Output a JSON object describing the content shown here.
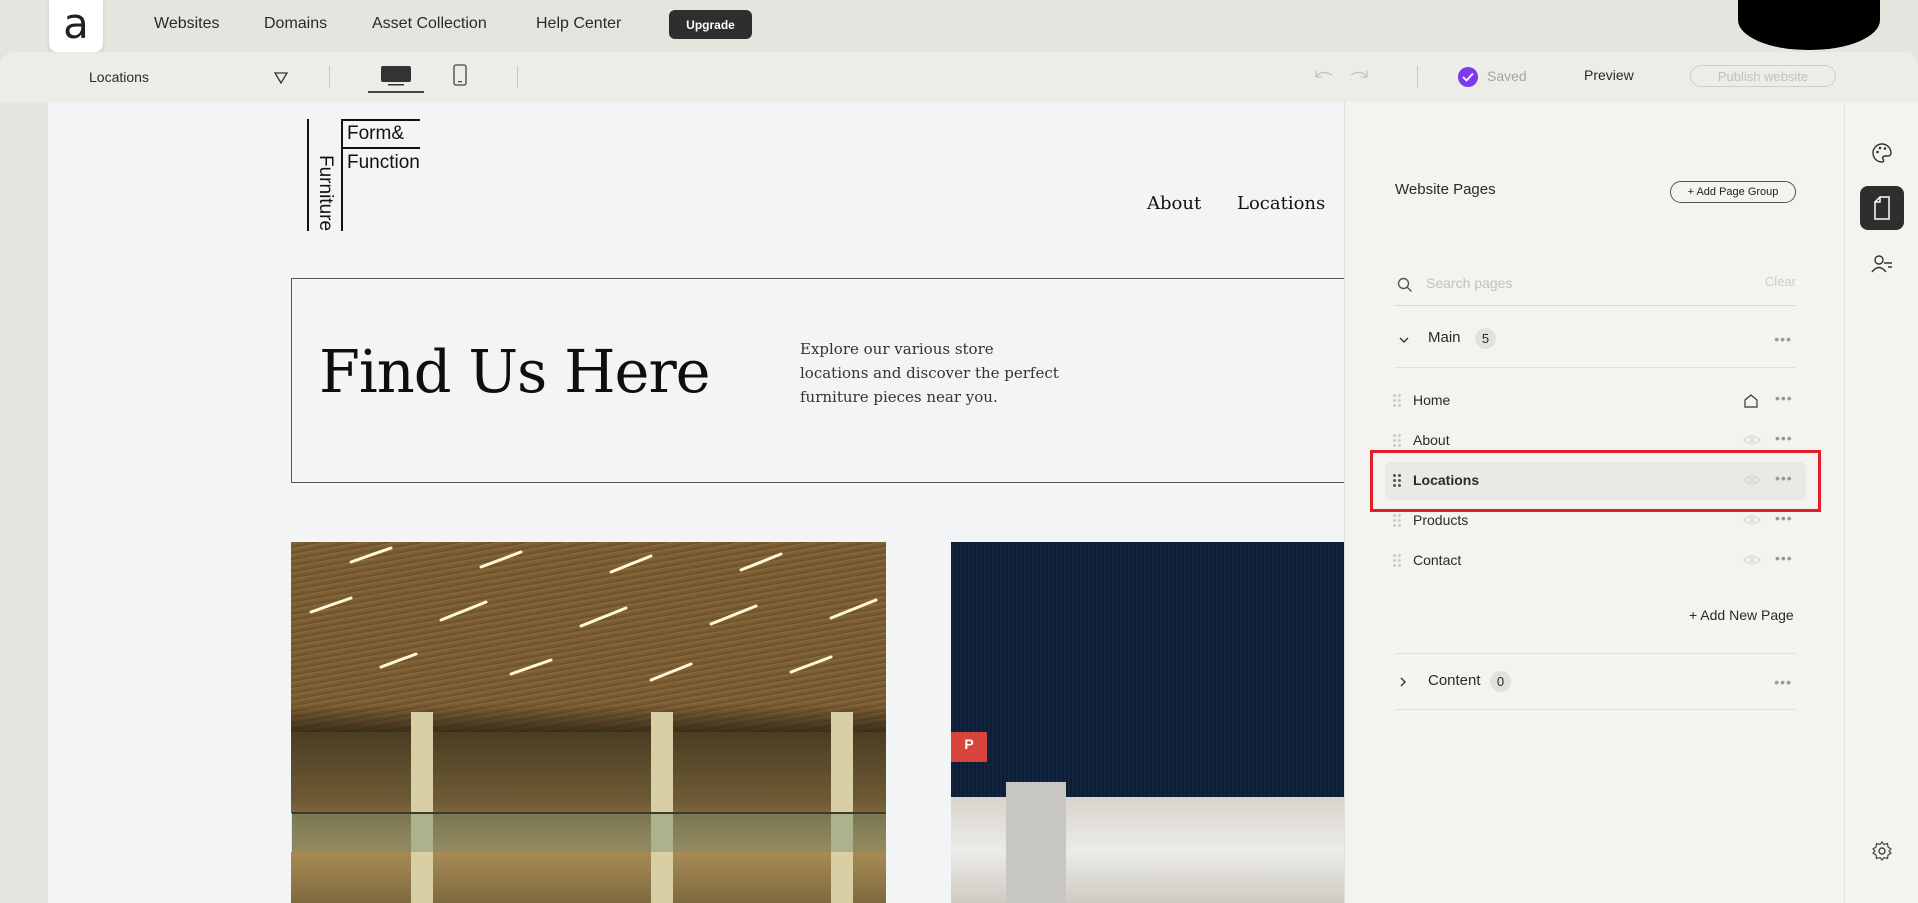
{
  "topnav": {
    "logo_letter": "a",
    "links": [
      "Websites",
      "Domains",
      "Asset Collection",
      "Help Center"
    ],
    "upgrade_label": "Upgrade"
  },
  "toolbar": {
    "current_page": "Locations",
    "saved_label": "Saved",
    "preview_label": "Preview",
    "publish_label": "Publish website"
  },
  "site": {
    "logo_line1": "Form&",
    "logo_line2": "Function",
    "logo_vertical": "Furniture",
    "nav": [
      "About",
      "Locations"
    ],
    "hero_title": "Find Us Here",
    "hero_desc": "Explore our various store locations and discover the perfect furniture pieces near you.",
    "parking_sign": "P"
  },
  "panel": {
    "title": "Website Pages",
    "add_group_label": "+ Add Page Group",
    "search_placeholder": "Search pages",
    "clear_label": "Clear",
    "groups": [
      {
        "label": "Main",
        "count": "5"
      },
      {
        "label": "Content",
        "count": "0"
      }
    ],
    "pages": [
      {
        "label": "Home",
        "icon": "home-icon"
      },
      {
        "label": "About",
        "icon": "eye-icon"
      },
      {
        "label": "Locations",
        "icon": "eye-icon",
        "active": true
      },
      {
        "label": "Products",
        "icon": "eye-icon"
      },
      {
        "label": "Contact",
        "icon": "eye-icon"
      }
    ],
    "add_page_label": "+ Add New Page"
  },
  "colors": {
    "accent": "#7c3aed",
    "highlight": "#e02028",
    "dark": "#2e2e2e"
  }
}
